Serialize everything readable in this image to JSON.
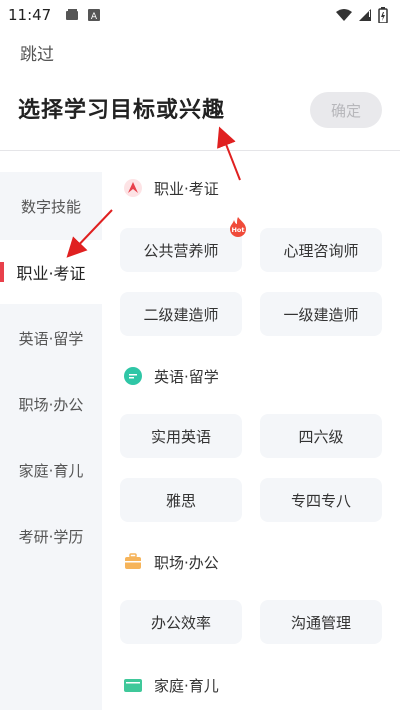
{
  "status_bar": {
    "time": "11:47",
    "left_icons": [
      "card-icon",
      "a-box-icon"
    ],
    "right_icons": [
      "wifi-icon",
      "signal-icon",
      "battery-icon"
    ]
  },
  "header": {
    "skip_label": "跳过",
    "title": "选择学习目标或兴趣",
    "confirm_label": "确定"
  },
  "sidebar": {
    "items": [
      {
        "label": "数字技能",
        "active": false
      },
      {
        "label": "职业·考证",
        "active": true
      },
      {
        "label": "英语·留学",
        "active": false
      },
      {
        "label": "职场·办公",
        "active": false
      },
      {
        "label": "家庭·育儿",
        "active": false
      },
      {
        "label": "考研·学历",
        "active": false
      }
    ]
  },
  "sections": [
    {
      "title": "职业·考证",
      "icon": "red-compass-icon",
      "chips": [
        "公共营养师",
        "心理咨询师",
        "二级建造师",
        "一级建造师"
      ]
    },
    {
      "title": "英语·留学",
      "icon": "green-bubble-icon",
      "chips": [
        "实用英语",
        "四六级",
        "雅思",
        "专四专八"
      ]
    },
    {
      "title": "职场·办公",
      "icon": "orange-briefcase-icon",
      "chips": [
        "办公效率",
        "沟通管理"
      ]
    },
    {
      "title": "家庭·育儿",
      "icon": "green-wallet-icon",
      "chips": []
    }
  ],
  "hot_badge": "Hot",
  "colors": {
    "accent_red": "#e8404b",
    "chip_bg": "#f4f6f9",
    "button_disabled_bg": "#e9e9ec"
  }
}
